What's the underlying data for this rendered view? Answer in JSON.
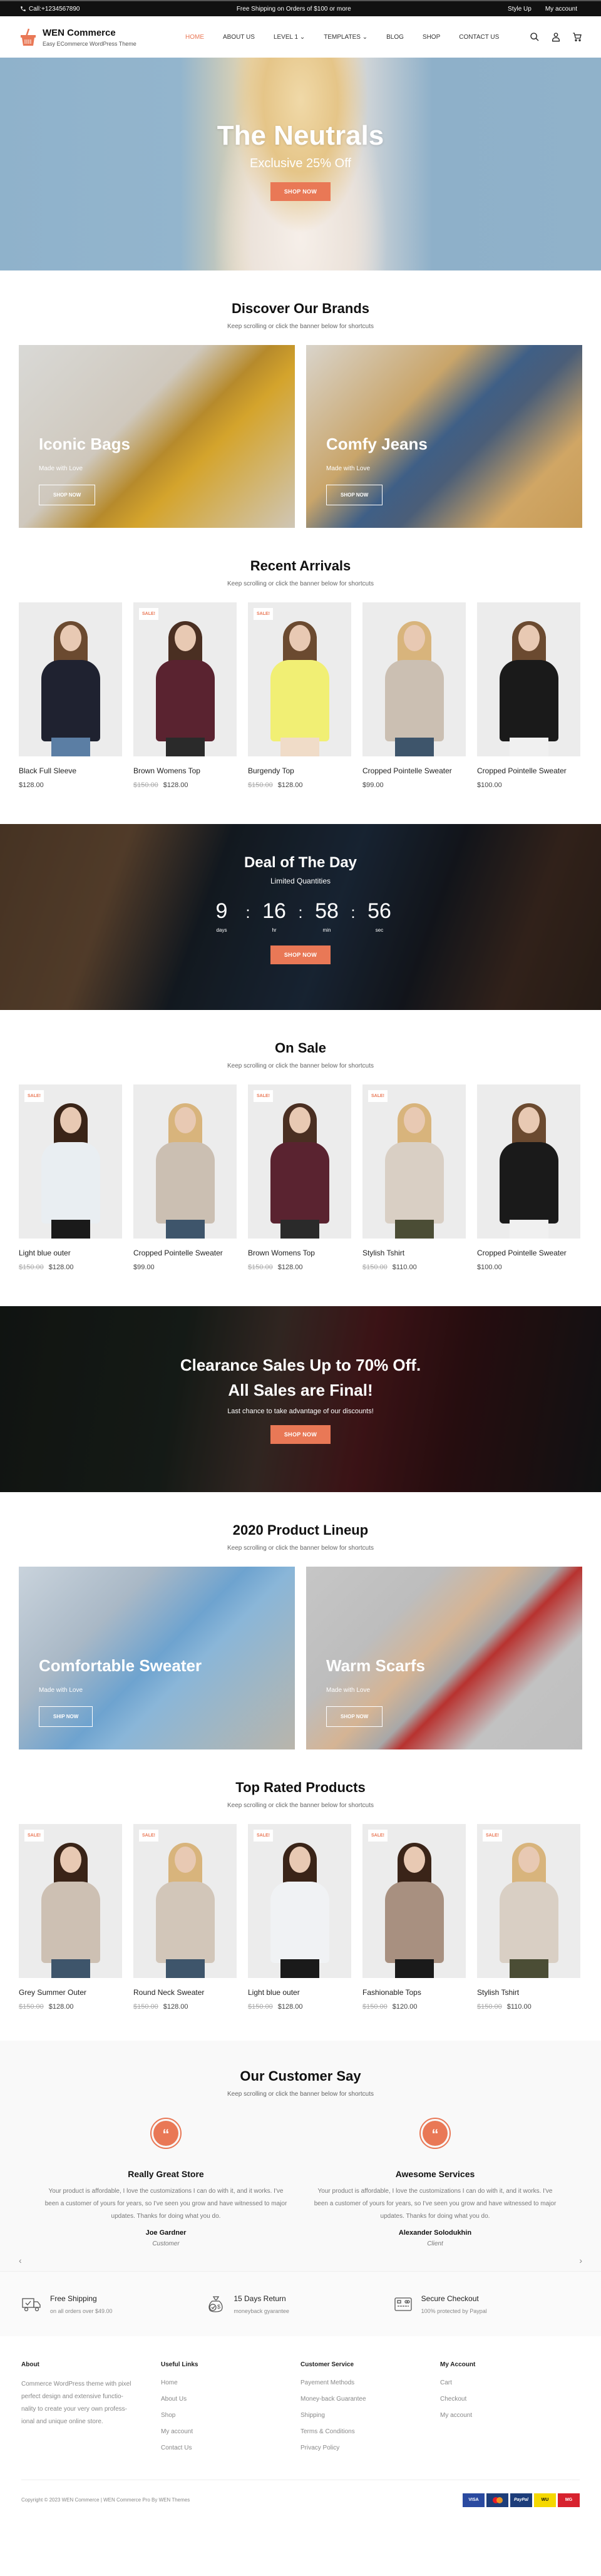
{
  "topbar": {
    "phone": "Call:+1234567890",
    "promo": "Free Shipping on Orders of $100 or more",
    "links": [
      "Style Up",
      "My account"
    ]
  },
  "header": {
    "site_name": "WEN Commerce",
    "tagline": "Easy ECommerce WordPress Theme",
    "nav": [
      {
        "label": "Home",
        "active": true
      },
      {
        "label": "About Us"
      },
      {
        "label": "Level 1",
        "dropdown": true
      },
      {
        "label": "Templates",
        "dropdown": true
      },
      {
        "label": "Blog"
      },
      {
        "label": "Shop"
      },
      {
        "label": "Contact Us"
      }
    ],
    "icons": [
      "search-icon",
      "user-icon",
      "cart-icon"
    ]
  },
  "hero": {
    "title": "The Neutrals",
    "subtitle": "Exclusive 25% Off",
    "button": "SHOP NOW"
  },
  "brands": {
    "title": "Discover Our Brands",
    "subtitle": "Keep scrolling or click the banner below for shortcuts",
    "banners": [
      {
        "title": "Iconic Bags",
        "sub": "Made with Love",
        "button": "SHOP NOW"
      },
      {
        "title": "Comfy Jeans",
        "sub": "Made with Love",
        "button": "SHOP NOW"
      }
    ]
  },
  "recent": {
    "title": "Recent Arrivals",
    "subtitle": "Keep scrolling or click the banner below for shortcuts",
    "products": [
      {
        "name": "Black Full Sleeve",
        "old": "",
        "price": "$128.00",
        "sale": false
      },
      {
        "name": "Brown Womens Top",
        "old": "$150.00",
        "price": "$128.00",
        "sale": true
      },
      {
        "name": "Burgendy Top",
        "old": "$150.00",
        "price": "$128.00",
        "sale": true
      },
      {
        "name": "Cropped Pointelle Sweater",
        "old": "",
        "price": "$99.00",
        "sale": false
      },
      {
        "name": "Cropped Pointelle Sweater",
        "old": "",
        "price": "$100.00",
        "sale": false
      }
    ]
  },
  "deal": {
    "title": "Deal of The Day",
    "subtitle": "Limited Quantities",
    "timer": [
      {
        "num": "9",
        "lbl": "days"
      },
      {
        "num": "16",
        "lbl": "hr"
      },
      {
        "num": "58",
        "lbl": "min"
      },
      {
        "num": "56",
        "lbl": "sec"
      }
    ],
    "button": "SHOP NOW"
  },
  "onsale": {
    "title": "On Sale",
    "subtitle": "Keep scrolling or click the banner below for shortcuts",
    "products": [
      {
        "name": "Light blue outer",
        "old": "$150.00",
        "price": "$128.00",
        "sale": true
      },
      {
        "name": "Cropped Pointelle Sweater",
        "old": "",
        "price": "$99.00",
        "sale": false
      },
      {
        "name": "Brown Womens Top",
        "old": "$150.00",
        "price": "$128.00",
        "sale": true
      },
      {
        "name": "Stylish Tshirt",
        "old": "$150.00",
        "price": "$110.00",
        "sale": true
      },
      {
        "name": "Cropped Pointelle Sweater",
        "old": "",
        "price": "$100.00",
        "sale": false
      }
    ]
  },
  "clearance": {
    "line1": "Clearance Sales Up to 70% Off.",
    "line2": "All Sales are Final!",
    "subtitle": "Last chance to take advantage of our discounts!",
    "button": "SHOP NOW"
  },
  "lineup": {
    "title": "2020 Product Lineup",
    "subtitle": "Keep scrolling or click the banner below for shortcuts",
    "banners": [
      {
        "title": "Comfortable Sweater",
        "sub": "Made with Love",
        "button": "SHIP NOW"
      },
      {
        "title": "Warm Scarfs",
        "sub": "Made with Love",
        "button": "SHOP NOW"
      }
    ]
  },
  "toprated": {
    "title": "Top Rated Products",
    "subtitle": "Keep scrolling or click the banner below for shortcuts",
    "products": [
      {
        "name": "Grey Summer Outer",
        "old": "$150.00",
        "price": "$128.00",
        "sale": true
      },
      {
        "name": "Round Neck Sweater",
        "old": "$150.00",
        "price": "$128.00",
        "sale": true
      },
      {
        "name": "Light blue outer",
        "old": "$150.00",
        "price": "$128.00",
        "sale": true
      },
      {
        "name": "Fashionable Tops",
        "old": "$150.00",
        "price": "$120.00",
        "sale": true
      },
      {
        "name": "Stylish Tshirt",
        "old": "$150.00",
        "price": "$110.00",
        "sale": true
      }
    ]
  },
  "sale_badge": "SALE!",
  "testimonials": {
    "title": "Our Customer Say",
    "subtitle": "Keep scrolling or click the banner below for shortcuts",
    "items": [
      {
        "heading": "Really Great Store",
        "text": "Your product is affordable, I love the customizations I can do with it, and it works. I've been a customer of yours for years, so I've seen you grow and have witnessed to major updates. Thanks for doing what you do.",
        "name": "Joe Gardner",
        "role": "Customer"
      },
      {
        "heading": "Awesome Services",
        "text": "Your product is affordable, I love the customizations I can do with it, and it works. I've been a customer of yours for years, so I've seen you grow and have witnessed to major updates. Thanks for doing what you do.",
        "name": "Alexander Solodukhin",
        "role": "Client"
      }
    ],
    "prev": "‹",
    "next": "›"
  },
  "features": [
    {
      "title": "Free Shipping",
      "sub": "on all orders over $49.00",
      "icon": "truck-icon"
    },
    {
      "title": "15 Days Return",
      "sub": "moneyback gyarantee",
      "icon": "money-bag-icon"
    },
    {
      "title": "Secure Checkout",
      "sub": "100% protected by Paypal",
      "icon": "card-icon"
    }
  ],
  "footer": {
    "about_title": "About",
    "about_text": "Commerce WordPress theme with pixel perfect design and extensive functio-nality to create your very own profess-ional and unique online store.",
    "cols": [
      {
        "title": "Useful Links",
        "links": [
          "Home",
          "About Us",
          "Shop",
          "My account",
          "Contact Us"
        ]
      },
      {
        "title": "Customer Service",
        "links": [
          "Payement Methods",
          "Money-back Guarantee",
          "Shipping",
          "Terms & Conditions",
          "Privacy Policy"
        ]
      },
      {
        "title": "My Account",
        "links": [
          "Cart",
          "Checkout",
          "My account"
        ]
      }
    ],
    "copyright": "Copyright © 2023 WEN Commerce | WEN Commerce Pro By WEN Themes",
    "payments": [
      {
        "label": "VISA",
        "color": "#2a4aa0"
      },
      {
        "label": "MC",
        "color": "#1d3d7a"
      },
      {
        "label": "PayPal",
        "color": "#1d3d7a"
      },
      {
        "label": "WU",
        "color": "#f5d800"
      },
      {
        "label": "MG",
        "color": "#d7222e"
      }
    ]
  },
  "colors": {
    "accent": "#e97856",
    "topbar": "#111111"
  }
}
